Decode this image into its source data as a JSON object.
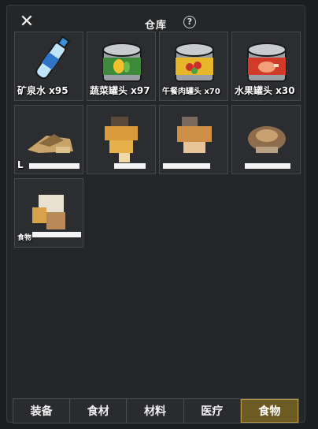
{
  "header": {
    "title": "仓库",
    "close_icon": "close-icon",
    "help_label": "?"
  },
  "items": [
    {
      "label": "矿泉水 x95",
      "icon": "water-bottle-icon"
    },
    {
      "label": "蔬菜罐头 x97",
      "icon": "vegetable-can-icon"
    },
    {
      "label": "午餐肉罐头 x70",
      "icon": "luncheon-meat-can-icon"
    },
    {
      "label": "水果罐头 x30",
      "icon": "fruit-can-icon"
    }
  ],
  "hidden_items": [
    {
      "icon": "food-item-icon",
      "label_fragment": "L"
    },
    {
      "icon": "food-item-icon"
    },
    {
      "icon": "food-item-icon"
    },
    {
      "icon": "food-item-icon"
    },
    {
      "icon": "food-item-icon",
      "label_fragment": "食物"
    }
  ],
  "tabs": [
    {
      "label": "装备",
      "active": false
    },
    {
      "label": "食材",
      "active": false
    },
    {
      "label": "材料",
      "active": false
    },
    {
      "label": "医疗",
      "active": false
    },
    {
      "label": "食物",
      "active": true
    }
  ],
  "colors": {
    "panel_bg": "#252628",
    "slot_bg": "#2c2d30",
    "active_tab": "#6d5b24"
  }
}
